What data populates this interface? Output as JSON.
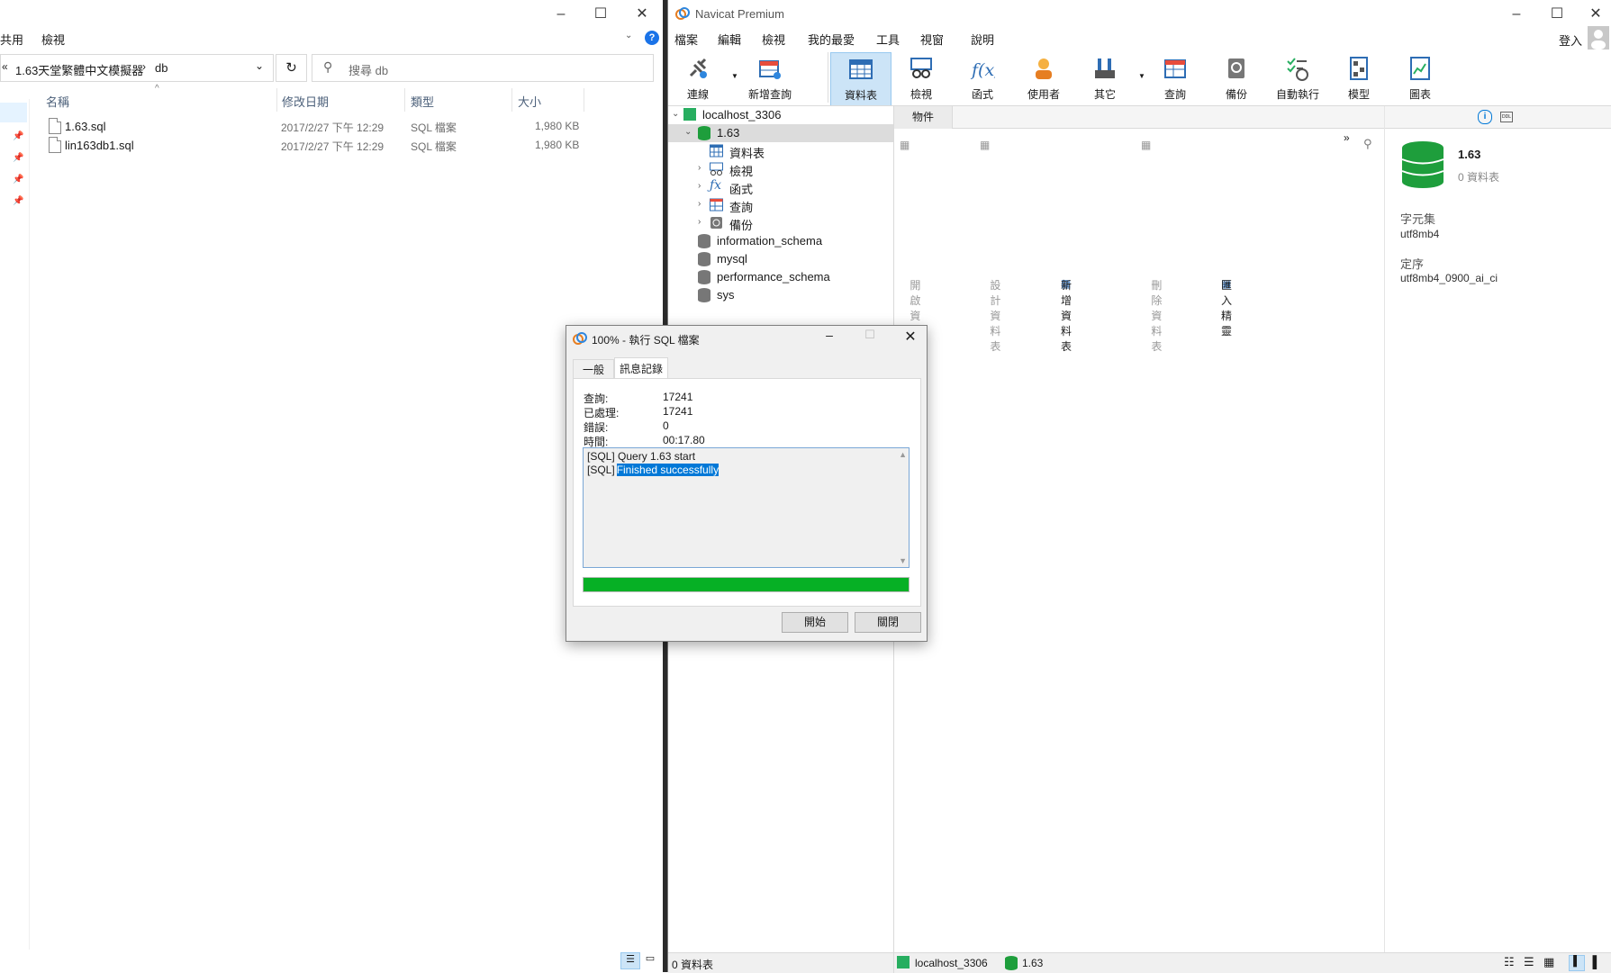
{
  "explorer": {
    "menu": [
      "共用",
      "檢視"
    ],
    "breadcrumb": [
      "1.63天堂繁體中文模擬器",
      "db"
    ],
    "search_placeholder": "搜尋 db",
    "columns": [
      "名稱",
      "修改日期",
      "類型",
      "大小"
    ],
    "files": [
      {
        "name": "1.63.sql",
        "date": "2017/2/27 下午 12:29",
        "type": "SQL 檔案",
        "size": "1,980 KB"
      },
      {
        "name": "lin163db1.sql",
        "date": "2017/2/27 下午 12:29",
        "type": "SQL 檔案",
        "size": "1,980 KB"
      }
    ]
  },
  "navicat": {
    "title": "Navicat Premium",
    "menu": [
      "檔案",
      "編輯",
      "檢視",
      "我的最愛",
      "工具",
      "視窗",
      "說明"
    ],
    "login": "登入",
    "toolbar": [
      "連線",
      "新增查詢",
      "資料表",
      "檢視",
      "函式",
      "使用者",
      "其它",
      "查詢",
      "備份",
      "自動執行",
      "模型",
      "圖表"
    ],
    "tree": {
      "connection": "localhost_3306",
      "database": "1.63",
      "children": [
        "資料表",
        "檢視",
        "函式",
        "查詢",
        "備份"
      ],
      "other_dbs": [
        "information_schema",
        "mysql",
        "performance_schema",
        "sys"
      ]
    },
    "objects_tab": "物件",
    "obj_actions": [
      "開啟資料表",
      "設計資料表",
      "新增資料表",
      "刪除資料表",
      "匯入精靈"
    ],
    "info": {
      "db_name": "1.63",
      "table_count": "0 資料表",
      "charset_label": "字元集",
      "charset": "utf8mb4",
      "collation_label": "定序",
      "collation": "utf8mb4_0900_ai_ci"
    },
    "status": {
      "left": "0 資料表",
      "connection": "localhost_3306",
      "db": "1.63"
    }
  },
  "dialog": {
    "title": "100% - 執行 SQL 檔案",
    "tabs": [
      "一般",
      "訊息記錄"
    ],
    "stats": [
      {
        "label": "查詢:",
        "value": "17241"
      },
      {
        "label": "已處理:",
        "value": "17241"
      },
      {
        "label": "錯誤:",
        "value": "0"
      },
      {
        "label": "時間:",
        "value": "00:17.80"
      }
    ],
    "log_line1": "[SQL] Query 1.63 start",
    "log_line2_prefix": "[SQL]",
    "log_line2_sel": "Finished successfully",
    "progress": 1.0,
    "buttons": [
      "開始",
      "關閉"
    ]
  },
  "colors": {
    "accent": "#0078d7",
    "progress": "#06b025",
    "db_green": "#1e9e3c"
  }
}
